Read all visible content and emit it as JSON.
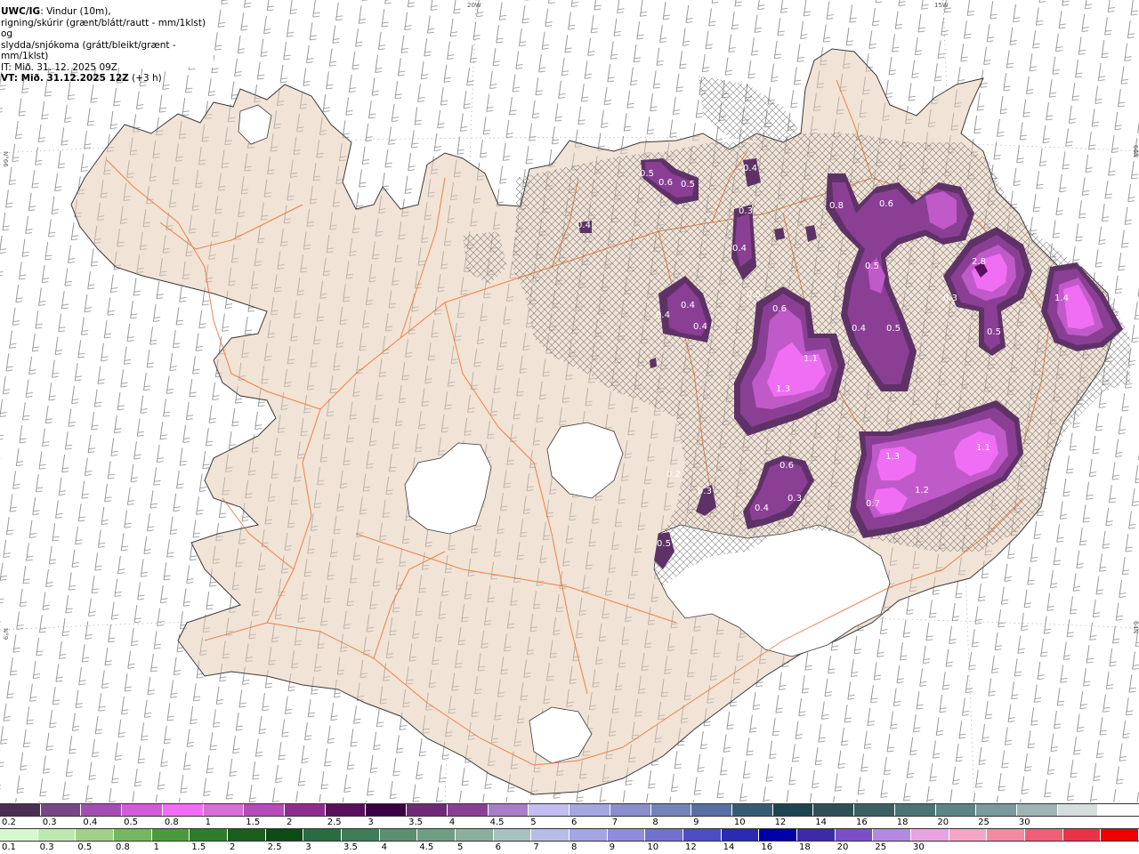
{
  "header": {
    "title": "UWC/IG",
    "line1_rest": ": Vindur (10m),",
    "line2": "rigning/skúrir (grænt/blátt/rautt - mm/1klst) og",
    "line3": "slydda/snjókoma (grátt/bleikt/grænt - mm/1klst)",
    "line4": "IT: Mið. 31. 12. 2025 09Z",
    "line5_bold": "VT: Mið. 31.12.2025 12Z",
    "line5_rest": " (+3 h)"
  },
  "graticule": {
    "lon_20w": "20W",
    "lon_15w": "15W",
    "lat_66n_left": "N°66",
    "lat_66n_right": "66N",
    "lat_64n_left": "N°9",
    "lat_64n_right": "64N"
  },
  "precip_labels": [
    "0.5",
    "0.6",
    "0.5",
    "0.4",
    "0.4",
    "0.3",
    "0.4",
    "0.5",
    "0.6",
    "0.8",
    "2.8",
    "0.4",
    "0.4",
    "0.4",
    "0.6",
    "0.5",
    "0.3",
    "1.4",
    "1.1",
    "1.3",
    "0.4",
    "0.5",
    "0.5",
    "0.6",
    "1.3",
    "1.1",
    "0.7",
    "1.2",
    "0.4",
    "0.3",
    "0.5",
    "0.2",
    "0.3"
  ],
  "legend": {
    "snow_colors": [
      "#4b2f52",
      "#7a4587",
      "#a44db3",
      "#d15cd7",
      "#f06ef4",
      "#d76ed8",
      "#b54cb9",
      "#8d2d90",
      "#5a0f5c",
      "#3a0042",
      "#6e2a77",
      "#8a3f95",
      "#a87ec8",
      "#c3bdf2",
      "#a5a7e2",
      "#8a8ecd",
      "#7384bc",
      "#5a6fa3",
      "#365c73",
      "#1d4550",
      "#2e5158",
      "#3a6064",
      "#4a7475",
      "#5d8585",
      "#7a9a9b",
      "#9fb4b3",
      "#d6dedd",
      "#ffffff"
    ],
    "snow_labels": [
      "0.2",
      "0.3",
      "0.4",
      "0.5",
      "0.8",
      "1",
      "1.5",
      "2",
      "2.5",
      "3",
      "3.5",
      "4",
      "4.5",
      "5",
      "6",
      "7",
      "8",
      "9",
      "10",
      "12",
      "14",
      "16",
      "18",
      "20",
      "25",
      "30"
    ],
    "rain_colors": [
      "#d8f7d0",
      "#bfe8b0",
      "#9fd18a",
      "#74b760",
      "#4c9a3e",
      "#2f7d2c",
      "#1c5f1c",
      "#0d4a15",
      "#2a6b40",
      "#3e7d55",
      "#5a9070",
      "#6f9e84",
      "#8aaf9c",
      "#a7c1c0",
      "#b8bde8",
      "#a2a6e3",
      "#8c8edd",
      "#6f72cf",
      "#4b4fc2",
      "#2a2ab2",
      "#0000a8",
      "#3d2aa8",
      "#7b4fc8",
      "#b38ae3",
      "#e6a4e0",
      "#f5a5c5",
      "#f38aa0",
      "#ef5f75",
      "#ea3348",
      "#f00000"
    ],
    "rain_labels": [
      "0.1",
      "0.3",
      "0.5",
      "0.8",
      "1",
      "1.5",
      "2",
      "2.5",
      "3",
      "3.5",
      "4",
      "4.5",
      "5",
      "6",
      "7",
      "8",
      "9",
      "10",
      "12",
      "14",
      "16",
      "18",
      "20",
      "25",
      "30"
    ]
  }
}
